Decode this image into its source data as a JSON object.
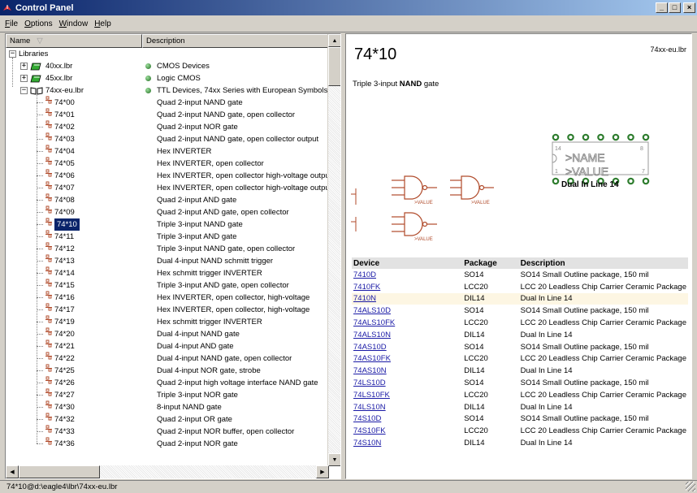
{
  "window": {
    "title": "Control Panel"
  },
  "menu": [
    {
      "pre": "",
      "u": "F",
      "post": "ile"
    },
    {
      "pre": "",
      "u": "O",
      "post": "ptions"
    },
    {
      "pre": "",
      "u": "W",
      "post": "indow"
    },
    {
      "pre": "",
      "u": "H",
      "post": "elp"
    }
  ],
  "tree_header": {
    "name": "Name",
    "description": "Description"
  },
  "tree": {
    "root": "Libraries",
    "libraries": [
      {
        "name": "40xx.lbr",
        "desc": "CMOS Devices",
        "expanded": false
      },
      {
        "name": "45xx.lbr",
        "desc": "Logic CMOS",
        "expanded": false
      },
      {
        "name": "74xx-eu.lbr",
        "desc": "TTL Devices, 74xx Series with European Symbols",
        "expanded": true
      }
    ],
    "devices": [
      {
        "name": "74*00",
        "desc": "Quad 2-input NAND gate"
      },
      {
        "name": "74*01",
        "desc": "Quad 2-input NAND gate, open collector"
      },
      {
        "name": "74*02",
        "desc": "Quad 2-input NOR gate"
      },
      {
        "name": "74*03",
        "desc": "Quad 2-input NAND gate, open collector output"
      },
      {
        "name": "74*04",
        "desc": "Hex INVERTER"
      },
      {
        "name": "74*05",
        "desc": "Hex INVERTER, open collector"
      },
      {
        "name": "74*06",
        "desc": "Hex INVERTER, open collector high-voltage output"
      },
      {
        "name": "74*07",
        "desc": "Hex INVERTER, open collector high-voltage output"
      },
      {
        "name": "74*08",
        "desc": "Quad 2-input AND gate"
      },
      {
        "name": "74*09",
        "desc": "Quad 2-input AND gate, open collector"
      },
      {
        "name": "74*10",
        "desc": "Triple 3-input NAND gate",
        "selected": true
      },
      {
        "name": "74*11",
        "desc": "Triple 3-input AND gate"
      },
      {
        "name": "74*12",
        "desc": "Triple 3-input NAND gate, open collector"
      },
      {
        "name": "74*13",
        "desc": "Dual 4-input NAND schmitt trigger"
      },
      {
        "name": "74*14",
        "desc": "Hex schmitt trigger INVERTER"
      },
      {
        "name": "74*15",
        "desc": "Triple 3-input AND gate, open collector"
      },
      {
        "name": "74*16",
        "desc": "Hex INVERTER, open collector, high-voltage"
      },
      {
        "name": "74*17",
        "desc": "Hex INVERTER, open collector, high-voltage"
      },
      {
        "name": "74*19",
        "desc": "Hex schmitt trigger INVERTER"
      },
      {
        "name": "74*20",
        "desc": "Dual 4-input NAND gate"
      },
      {
        "name": "74*21",
        "desc": "Dual 4-input AND gate"
      },
      {
        "name": "74*22",
        "desc": "Dual 4-input NAND gate, open collector"
      },
      {
        "name": "74*25",
        "desc": "Dual 4-input NOR gate, strobe"
      },
      {
        "name": "74*26",
        "desc": "Quad 2-input high voltage interface NAND gate"
      },
      {
        "name": "74*27",
        "desc": "Triple 3-input NOR gate"
      },
      {
        "name": "74*30",
        "desc": "8-input NAND gate"
      },
      {
        "name": "74*32",
        "desc": "Quad 2-input OR gate"
      },
      {
        "name": "74*33",
        "desc": "Quad 2-input NOR buffer, open collector"
      },
      {
        "name": "74*36",
        "desc": "Quad 2-input NOR gate"
      }
    ]
  },
  "detail": {
    "title": "74*10",
    "library": "74xx-eu.lbr",
    "desc_pre": "Triple 3-input ",
    "desc_bold": "NAND",
    "desc_post": " gate",
    "package_label": "Dual In Line 14",
    "ic_name": ">NAME",
    "ic_value": ">VALUE",
    "pin_14": "14",
    "pin_8": "8",
    "pin_1": "1",
    "pin_7": "7",
    "gate_value_label": ">VALUE"
  },
  "device_table": {
    "headers": [
      "Device",
      "Package",
      "Description"
    ],
    "rows": [
      [
        "7410D",
        "SO14",
        "SO14 Small Outline package, 150 mil"
      ],
      [
        "7410FK",
        "LCC20",
        "LCC 20 Leadless Chip Carrier Ceramic Package"
      ],
      [
        "7410N",
        "DIL14",
        "Dual In Line 14"
      ],
      [
        "74ALS10D",
        "SO14",
        "SO14 Small Outline package, 150 mil"
      ],
      [
        "74ALS10FK",
        "LCC20",
        "LCC 20 Leadless Chip Carrier Ceramic Package"
      ],
      [
        "74ALS10N",
        "DIL14",
        "Dual In Line 14"
      ],
      [
        "74AS10D",
        "SO14",
        "SO14 Small Outline package, 150 mil"
      ],
      [
        "74AS10FK",
        "LCC20",
        "LCC 20 Leadless Chip Carrier Ceramic Package"
      ],
      [
        "74AS10N",
        "DIL14",
        "Dual In Line 14"
      ],
      [
        "74LS10D",
        "SO14",
        "SO14 Small Outline package, 150 mil"
      ],
      [
        "74LS10FK",
        "LCC20",
        "LCC 20 Leadless Chip Carrier Ceramic Package"
      ],
      [
        "74LS10N",
        "DIL14",
        "Dual In Line 14"
      ],
      [
        "74S10D",
        "SO14",
        "SO14 Small Outline package, 150 mil"
      ],
      [
        "74S10FK",
        "LCC20",
        "LCC 20 Leadless Chip Carrier Ceramic Package"
      ],
      [
        "74S10N",
        "DIL14",
        "Dual In Line 14"
      ]
    ],
    "highlight_row": 2
  },
  "status": {
    "text": "74*10@d:\\eagle4\\lbr\\74xx-eu.lbr"
  },
  "colors": {
    "title_start": "#0a246a",
    "title_end": "#a6caf0",
    "selection": "#0a246a",
    "link": "#1a1aa6",
    "symbol": "#b04a2a",
    "pad": "#2e7d2e"
  }
}
